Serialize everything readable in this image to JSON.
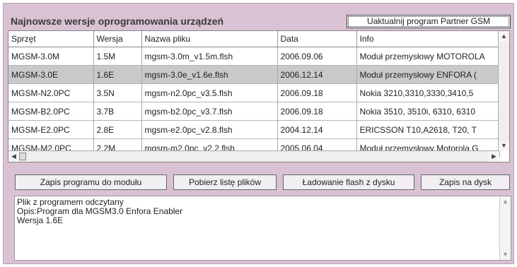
{
  "header": {
    "title": "Najnowsze wersje oprogramowania urządzeń",
    "update_button": "Uaktualnij program Partner GSM"
  },
  "table": {
    "columns": [
      "Sprzęt",
      "Wersja",
      "Nazwa pliku",
      "Data",
      "Info"
    ],
    "rows": [
      [
        "MGSM-3.0M",
        "1.5M",
        "mgsm-3.0m_v1.5m.flsh",
        "2006.09.06",
        "Moduł przemysłowy MOTOROLA"
      ],
      [
        "MGSM-3.0E",
        "1.6E",
        "mgsm-3.0e_v1.6e.flsh",
        "2006.12.14",
        "Moduł przemysłowy ENFORA ("
      ],
      [
        "MGSM-N2.0PC",
        "3.5N",
        "mgsm-n2.0pc_v3.5.flsh",
        "2006.09.18",
        "Nokia 3210,3310,3330,3410,5"
      ],
      [
        "MGSM-B2.0PC",
        "3.7B",
        "mgsm-b2.0pc_v3.7.flsh",
        "2006.09.18",
        "Nokia 3510, 3510i, 6310, 6310"
      ],
      [
        "MGSM-E2.0PC",
        "2.8E",
        "mgsm-e2.0pc_v2.8.flsh",
        "2004.12.14",
        "ERICSSON T10,A2618, T20, T"
      ],
      [
        "MGSM-M2.0PC",
        "2.2M",
        "mgsm-m2.0pc_v2.2.flsh",
        "2005.06.04",
        "Moduł przemysłowy Motorola G"
      ]
    ],
    "selected_row": 1
  },
  "buttons": {
    "write_module": "Zapis programu do modułu",
    "download_list": "Pobierz listę plików",
    "load_flash": "Ładowanie flash z dysku",
    "save_disk": "Zapis na dysk"
  },
  "log": {
    "lines": [
      "Plik z programem odczytany",
      "Opis:Program dla MGSM3.0 Enfora Enabler",
      "Wersja 1.6E"
    ]
  },
  "icons": {
    "scroll_up": "scroll-up-arrow",
    "scroll_down": "scroll-down-arrow",
    "scroll_left": "scroll-left-arrow",
    "scroll_right": "scroll-right-arrow"
  },
  "colors": {
    "panel_background": "#d9c2d3",
    "selected_row": "#c9c9c9"
  }
}
